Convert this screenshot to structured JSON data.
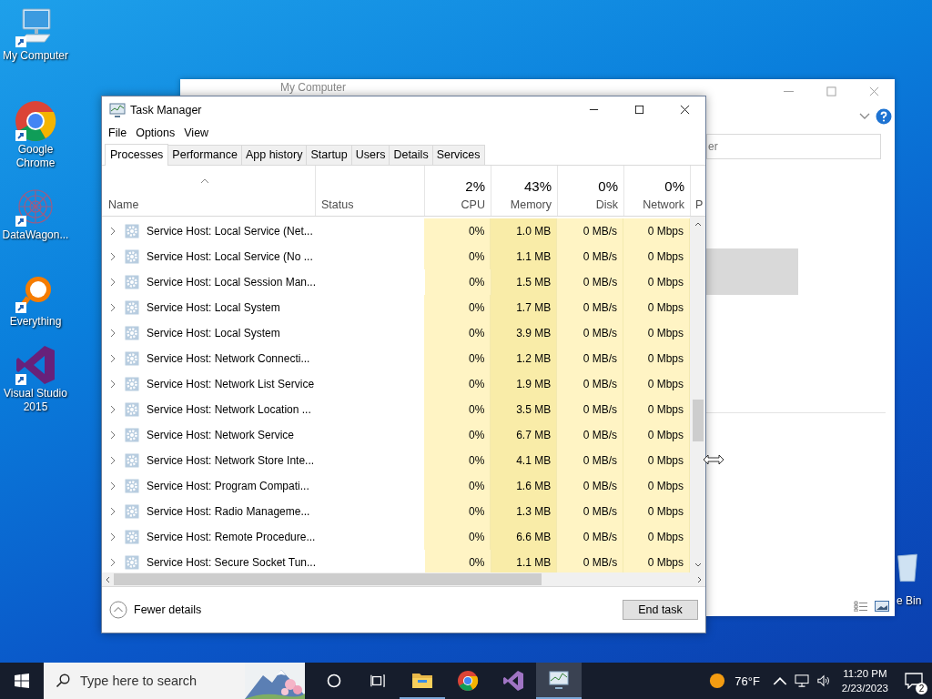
{
  "desktop_icons": [
    {
      "kind": "computer",
      "label": "My Computer"
    },
    {
      "kind": "chrome",
      "label": "Google Chrome"
    },
    {
      "kind": "mesh",
      "label": "DataWagon..."
    },
    {
      "kind": "everything",
      "label": "Everything"
    },
    {
      "kind": "vs",
      "label": "Visual Studio 2015"
    }
  ],
  "recycle_bin": {
    "label": "e Bin"
  },
  "explorer": {
    "title": "My Computer",
    "search_text": "er"
  },
  "task_manager": {
    "title": "Task Manager",
    "menu": [
      "File",
      "Options",
      "View"
    ],
    "tabs": [
      {
        "label": "Processes",
        "selected": true
      },
      {
        "label": "Performance",
        "selected": false
      },
      {
        "label": "App history",
        "selected": false
      },
      {
        "label": "Startup",
        "selected": false
      },
      {
        "label": "Users",
        "selected": false
      },
      {
        "label": "Details",
        "selected": false
      },
      {
        "label": "Services",
        "selected": false
      }
    ],
    "columns": [
      {
        "label": "Name"
      },
      {
        "label": "Status"
      },
      {
        "label": "CPU",
        "percent": "2%"
      },
      {
        "label": "Memory",
        "percent": "43%"
      },
      {
        "label": "Disk",
        "percent": "0%"
      },
      {
        "label": "Network",
        "percent": "0%"
      },
      {
        "label": "P"
      }
    ],
    "rows": [
      {
        "name": "Service Host: Local Service (Net...",
        "cpu": "0%",
        "memory": "1.0 MB",
        "disk": "0 MB/s",
        "network": "0 Mbps"
      },
      {
        "name": "Service Host: Local Service (No ...",
        "cpu": "0%",
        "memory": "1.1 MB",
        "disk": "0 MB/s",
        "network": "0 Mbps"
      },
      {
        "name": "Service Host: Local Session Man...",
        "cpu": "0%",
        "memory": "1.5 MB",
        "disk": "0 MB/s",
        "network": "0 Mbps"
      },
      {
        "name": "Service Host: Local System",
        "cpu": "0%",
        "memory": "1.7 MB",
        "disk": "0 MB/s",
        "network": "0 Mbps"
      },
      {
        "name": "Service Host: Local System",
        "cpu": "0%",
        "memory": "3.9 MB",
        "disk": "0 MB/s",
        "network": "0 Mbps"
      },
      {
        "name": "Service Host: Network Connecti...",
        "cpu": "0%",
        "memory": "1.2 MB",
        "disk": "0 MB/s",
        "network": "0 Mbps"
      },
      {
        "name": "Service Host: Network List Service",
        "cpu": "0%",
        "memory": "1.9 MB",
        "disk": "0 MB/s",
        "network": "0 Mbps"
      },
      {
        "name": "Service Host: Network Location ...",
        "cpu": "0%",
        "memory": "3.5 MB",
        "disk": "0 MB/s",
        "network": "0 Mbps"
      },
      {
        "name": "Service Host: Network Service",
        "cpu": "0%",
        "memory": "6.7 MB",
        "disk": "0 MB/s",
        "network": "0 Mbps"
      },
      {
        "name": "Service Host: Network Store Inte...",
        "cpu": "0%",
        "memory": "4.1 MB",
        "disk": "0 MB/s",
        "network": "0 Mbps"
      },
      {
        "name": "Service Host: Program Compati...",
        "cpu": "0%",
        "memory": "1.6 MB",
        "disk": "0 MB/s",
        "network": "0 Mbps"
      },
      {
        "name": "Service Host: Radio Manageme...",
        "cpu": "0%",
        "memory": "1.3 MB",
        "disk": "0 MB/s",
        "network": "0 Mbps"
      },
      {
        "name": "Service Host: Remote Procedure...",
        "cpu": "0%",
        "memory": "6.6 MB",
        "disk": "0 MB/s",
        "network": "0 Mbps"
      },
      {
        "name": "Service Host: Secure Socket Tun...",
        "cpu": "0%",
        "memory": "1.1 MB",
        "disk": "0 MB/s",
        "network": "0 Mbps"
      }
    ],
    "fewer_details": "Fewer details",
    "end_task": "End task"
  },
  "taskbar": {
    "search_placeholder": "Type here to search",
    "apps": [
      {
        "kind": "explorer",
        "running": true,
        "selected": false
      },
      {
        "kind": "chrome",
        "running": false,
        "selected": false
      },
      {
        "kind": "vs",
        "running": false,
        "selected": false
      },
      {
        "kind": "taskmgr",
        "running": true,
        "selected": true
      }
    ],
    "temperature": "76°F",
    "time": "11:20 PM",
    "date": "2/23/2023",
    "notifications": "2"
  }
}
